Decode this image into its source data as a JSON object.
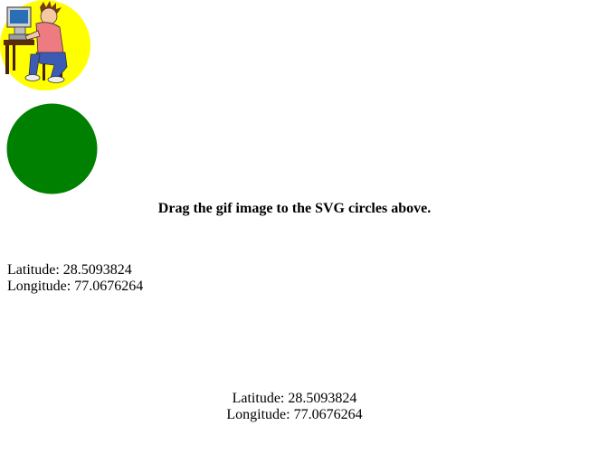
{
  "drag_image": {
    "icon": "man-at-computer-icon",
    "background_color": "#ffff00"
  },
  "drop_target": {
    "icon": "green-circle",
    "fill_color": "#008000"
  },
  "instruction": "Drag the gif image to the SVG circles above.",
  "location_block_1": {
    "latitude_label": "Latitude: 28.5093824",
    "longitude_label": "Longitude: 77.0676264"
  },
  "location_block_2": {
    "latitude_label": "Latitude: 28.5093824",
    "longitude_label": "Longitude: 77.0676264"
  }
}
